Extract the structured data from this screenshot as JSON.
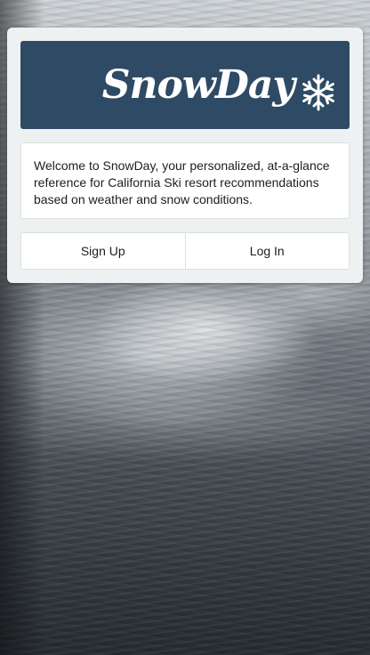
{
  "app": {
    "brand_name": "SnowDay",
    "brand_color": "#2e4a65",
    "logo_icon": "snowflake-icon"
  },
  "welcome": {
    "message": "Welcome to SnowDay, your personalized, at-a-glance reference for California Ski resort recommendations based on weather and snow conditions."
  },
  "actions": {
    "sign_up_label": "Sign Up",
    "log_in_label": "Log In"
  }
}
